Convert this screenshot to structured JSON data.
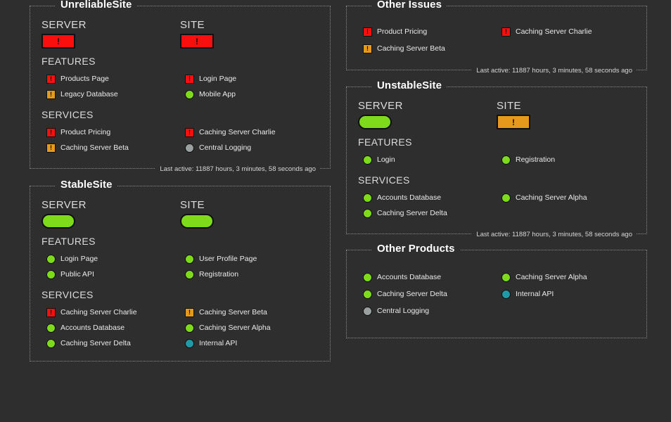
{
  "colors": {
    "background": "#2e2e2e",
    "panel_border": "#8a8a8a",
    "status_ok": "#7ddb1b",
    "status_bad": "#fa0f0f",
    "status_warn": "#e69a1c",
    "status_off": "#9aa0a0",
    "status_info": "#1f9aa6",
    "title_text": "#ffffff",
    "label_text": "#dcdcdc"
  },
  "shared": {
    "server_label": "SERVER",
    "site_label": "SITE",
    "features_label": "FEATURES",
    "services_label": "SERVICES",
    "last_active": "Last active: 11887 hours, 3 minutes, 58 seconds ago",
    "alert_glyph": "!"
  },
  "panels": {
    "unreliable_site": {
      "title": "UnreliableSite",
      "server_status": "bad",
      "site_status": "bad",
      "features": [
        {
          "label": "Products Page",
          "status": "bad"
        },
        {
          "label": "Login Page",
          "status": "bad"
        },
        {
          "label": "Legacy Database",
          "status": "warn"
        },
        {
          "label": "Mobile App",
          "status": "ok"
        }
      ],
      "services": [
        {
          "label": "Product Pricing",
          "status": "bad"
        },
        {
          "label": "Caching Server Charlie",
          "status": "bad"
        },
        {
          "label": "Caching Server Beta",
          "status": "warn"
        },
        {
          "label": "Central Logging",
          "status": "off"
        }
      ],
      "footer": "Last active: 11887 hours, 3 minutes, 58 seconds ago"
    },
    "stable_site": {
      "title": "StableSite",
      "server_status": "ok",
      "site_status": "ok",
      "features": [
        {
          "label": "Login Page",
          "status": "ok"
        },
        {
          "label": "User Profile Page",
          "status": "ok"
        },
        {
          "label": "Public API",
          "status": "ok"
        },
        {
          "label": "Registration",
          "status": "ok"
        }
      ],
      "services": [
        {
          "label": "Caching Server Charlie",
          "status": "bad"
        },
        {
          "label": "Caching Server Beta",
          "status": "warn"
        },
        {
          "label": "Accounts Database",
          "status": "ok"
        },
        {
          "label": "Caching Server Alpha",
          "status": "ok"
        },
        {
          "label": "Caching Server Delta",
          "status": "ok"
        },
        {
          "label": "Internal API",
          "status": "info"
        }
      ],
      "footer": null
    },
    "other_issues": {
      "title": "Other Issues",
      "items": [
        {
          "label": "Product Pricing",
          "status": "bad"
        },
        {
          "label": "Caching Server Charlie",
          "status": "bad"
        },
        {
          "label": "Caching Server Beta",
          "status": "warn"
        }
      ],
      "footer": "Last active: 11887 hours, 3 minutes, 58 seconds ago"
    },
    "unstable_site": {
      "title": "UnstableSite",
      "server_status": "ok",
      "site_status": "warn",
      "features": [
        {
          "label": "Login",
          "status": "ok"
        },
        {
          "label": "Registration",
          "status": "ok"
        }
      ],
      "services": [
        {
          "label": "Accounts Database",
          "status": "ok"
        },
        {
          "label": "Caching Server Alpha",
          "status": "ok"
        },
        {
          "label": "Caching Server Delta",
          "status": "ok"
        }
      ],
      "footer": "Last active: 11887 hours, 3 minutes, 58 seconds ago"
    },
    "other_products": {
      "title": "Other Products",
      "items": [
        {
          "label": "Accounts Database",
          "status": "ok"
        },
        {
          "label": "Caching Server Alpha",
          "status": "ok"
        },
        {
          "label": "Caching Server Delta",
          "status": "ok"
        },
        {
          "label": "Internal API",
          "status": "info"
        },
        {
          "label": "Central Logging",
          "status": "off"
        }
      ],
      "footer": null
    }
  }
}
